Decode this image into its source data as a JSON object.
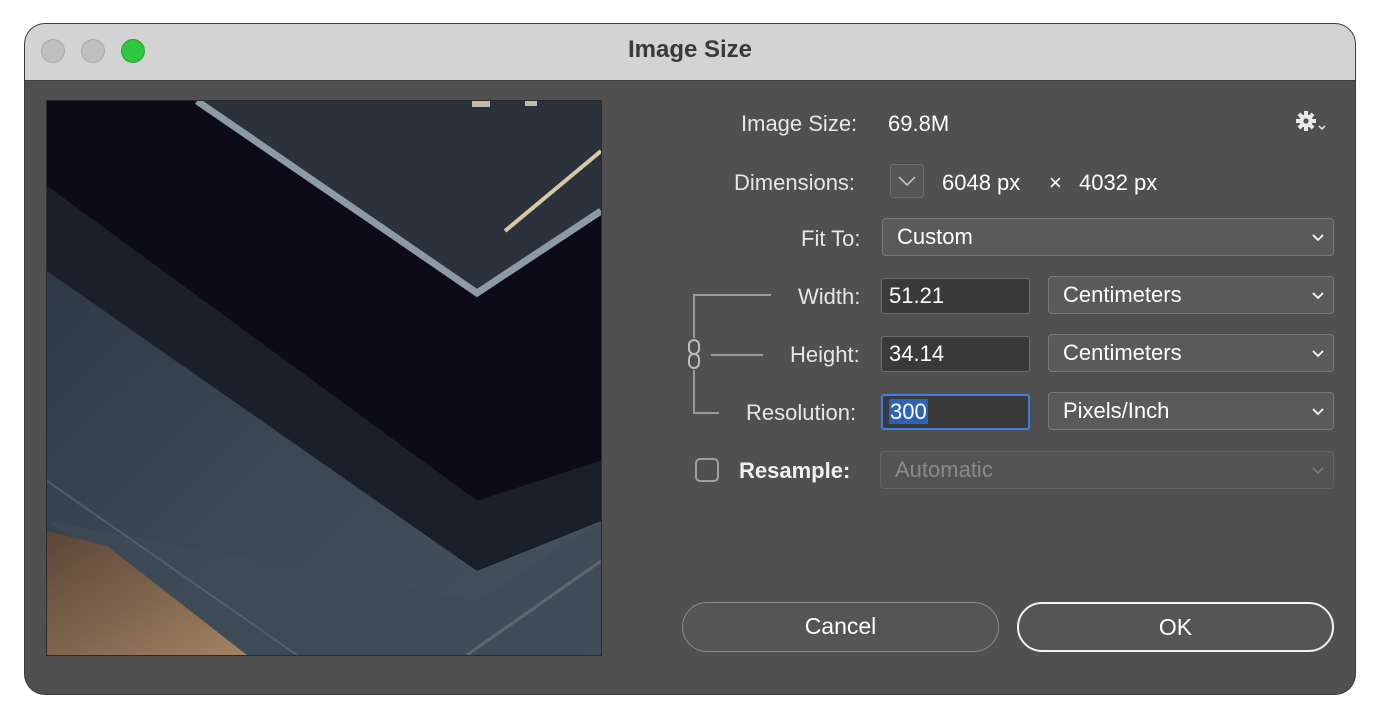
{
  "window": {
    "title": "Image Size"
  },
  "info": {
    "image_size_label": "Image Size:",
    "image_size_value": "69.8M",
    "dimensions_label": "Dimensions:",
    "dimensions_width": "6048 px",
    "dimensions_times": "×",
    "dimensions_height": "4032 px"
  },
  "fit_to": {
    "label": "Fit To:",
    "value": "Custom"
  },
  "width": {
    "label": "Width:",
    "value": "51.21",
    "unit": "Centimeters"
  },
  "height": {
    "label": "Height:",
    "value": "34.14",
    "unit": "Centimeters"
  },
  "resolution": {
    "label": "Resolution:",
    "value": "300",
    "unit": "Pixels/Inch"
  },
  "resample": {
    "label": "Resample:",
    "checked": false,
    "value": "Automatic"
  },
  "buttons": {
    "cancel": "Cancel",
    "ok": "OK"
  },
  "icons": {
    "settings": "gear-icon",
    "dimensions_toggle": "chevron-down-icon",
    "constrain": "link-icon"
  },
  "colors": {
    "focus": "#3c7ee0",
    "maximize": "#2dc840",
    "window_bg": "#505050"
  }
}
